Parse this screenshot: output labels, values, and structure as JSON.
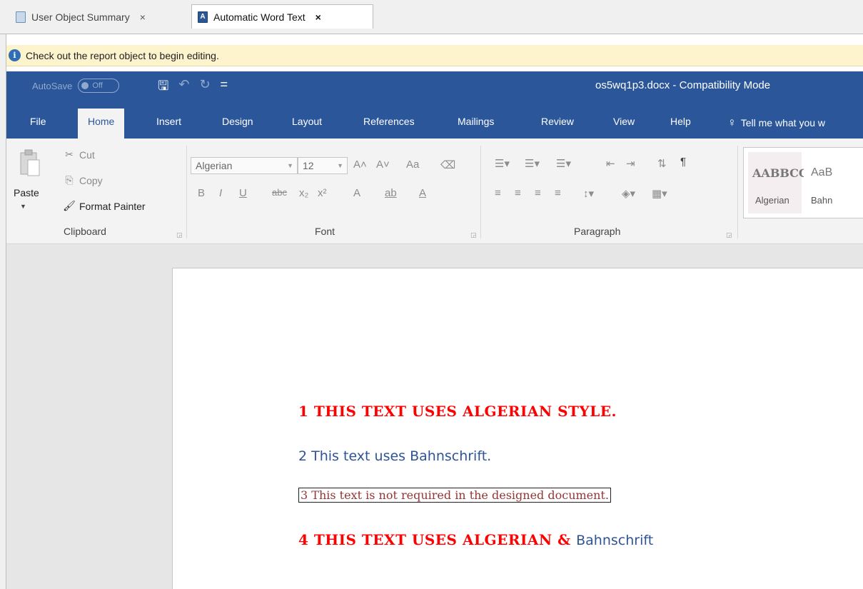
{
  "outer_tabs": [
    {
      "label": "User Object Summary",
      "close": "×"
    },
    {
      "label": "Automatic Word Text",
      "close": "×"
    }
  ],
  "infobar": {
    "icon": "i",
    "message": "Check out the report object to begin editing."
  },
  "titlebar": {
    "autosave_label": "AutoSave",
    "autosave_state": "Off",
    "qat_save": "🖫",
    "qat_undo": "↶",
    "qat_redo": "↻",
    "qat_more": "=",
    "document_title": "os5wq1p3.docx  -  Compatibility Mode"
  },
  "ribbon_tabs": [
    "File",
    "Home",
    "Insert",
    "Design",
    "Layout",
    "References",
    "Mailings",
    "Review",
    "View",
    "Help"
  ],
  "tell_me": "Tell me what you w",
  "clipboard": {
    "paste": "Paste",
    "cut": "Cut",
    "copy": "Copy",
    "format_painter": "Format Painter",
    "group_label": "Clipboard"
  },
  "font": {
    "font_name": "Algerian",
    "font_size": "12",
    "group_label": "Font",
    "case_label": "Aa",
    "row2": [
      "B",
      "I",
      "U",
      "abc",
      "x₂",
      "x²",
      "A",
      "ab",
      "A"
    ]
  },
  "paragraph": {
    "group_label": "Paragraph",
    "pilcrow": "¶"
  },
  "styles": [
    {
      "sample": "AABBCC",
      "name": "Algerian"
    },
    {
      "sample": "AaB",
      "name": "Bahn"
    }
  ],
  "document": {
    "line1": "1 THIS TEXT USES ALGERIAN STYLE.",
    "line2": "2 This text uses Bahnschrift.",
    "line3": "3 This text is not required in the designed document.",
    "line4_part1": "4 THIS TEXT USES ALGERIAN & ",
    "line4_part2": "Bahnschrift"
  }
}
